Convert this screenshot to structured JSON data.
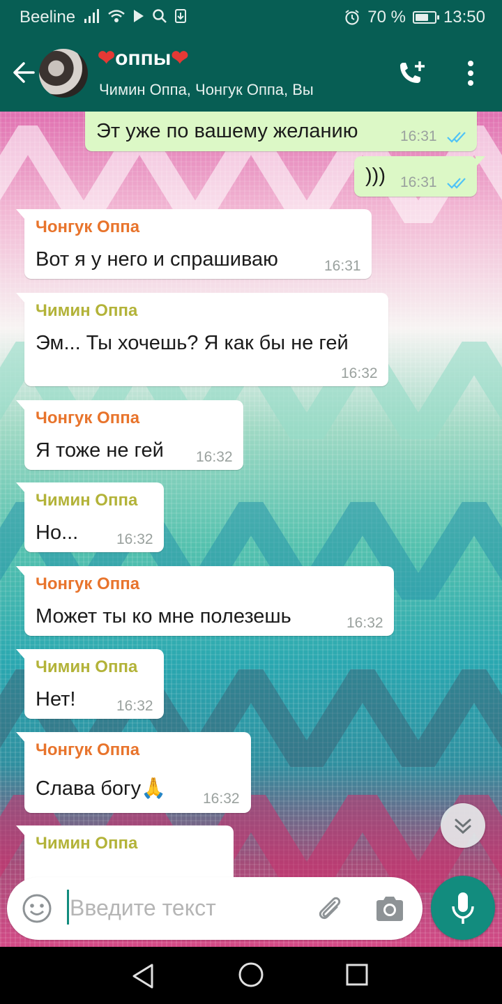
{
  "status_bar": {
    "carrier": "Beeline",
    "battery_percent": "70 %",
    "battery_level": 0.7,
    "time": "13:50"
  },
  "header": {
    "title_heart_left": "❤",
    "title_text": "оппы",
    "title_heart_right": "❤",
    "subtitle": "Чимин Оппа, Чонгук Оппа, Вы"
  },
  "messages": [
    {
      "direction": "out",
      "text": "Эт уже по вашему желанию",
      "time": "16:31",
      "status": "read"
    },
    {
      "direction": "out",
      "text": ")))",
      "time": "16:31",
      "status": "read"
    },
    {
      "direction": "in",
      "sender": "Чонгук Оппа",
      "text": "Вот я у него и спрашиваю",
      "time": "16:31"
    },
    {
      "direction": "in",
      "sender": "Чимин Оппа",
      "text": "Эм... Ты хочешь? Я как бы не гей",
      "time": "16:32"
    },
    {
      "direction": "in",
      "sender": "Чонгук Оппа",
      "text": "Я тоже не гей",
      "time": "16:32"
    },
    {
      "direction": "in",
      "sender": "Чимин Оппа",
      "text": "Но...",
      "time": "16:32"
    },
    {
      "direction": "in",
      "sender": "Чонгук Оппа",
      "text": "Может ты ко мне полезешь",
      "time": "16:32"
    },
    {
      "direction": "in",
      "sender": "Чимин Оппа",
      "text": "Нет!",
      "time": "16:32"
    },
    {
      "direction": "in",
      "sender": "Чонгук Оппа",
      "text": "Слава богу🙏",
      "time": "16:32"
    },
    {
      "direction": "in",
      "sender": "Чимин Оппа",
      "text": "",
      "time": ""
    }
  ],
  "input": {
    "placeholder": "Введите текст"
  },
  "colors": {
    "header": "#075E54",
    "accent": "#128C7E",
    "outgoing_bubble": "#dcf8c6",
    "incoming_bubble": "#ffffff",
    "read_ticks": "#4fc3f7",
    "sender_orange": "#e8742c",
    "sender_olive": "#b3b339"
  },
  "icons": {
    "back": "arrow-left-icon",
    "call_add": "add-call-icon",
    "menu": "more-vert-icon",
    "emoji": "smiley-icon",
    "attach": "paperclip-icon",
    "camera": "camera-icon",
    "mic": "microphone-icon",
    "scroll_down": "double-chevron-down-icon"
  }
}
